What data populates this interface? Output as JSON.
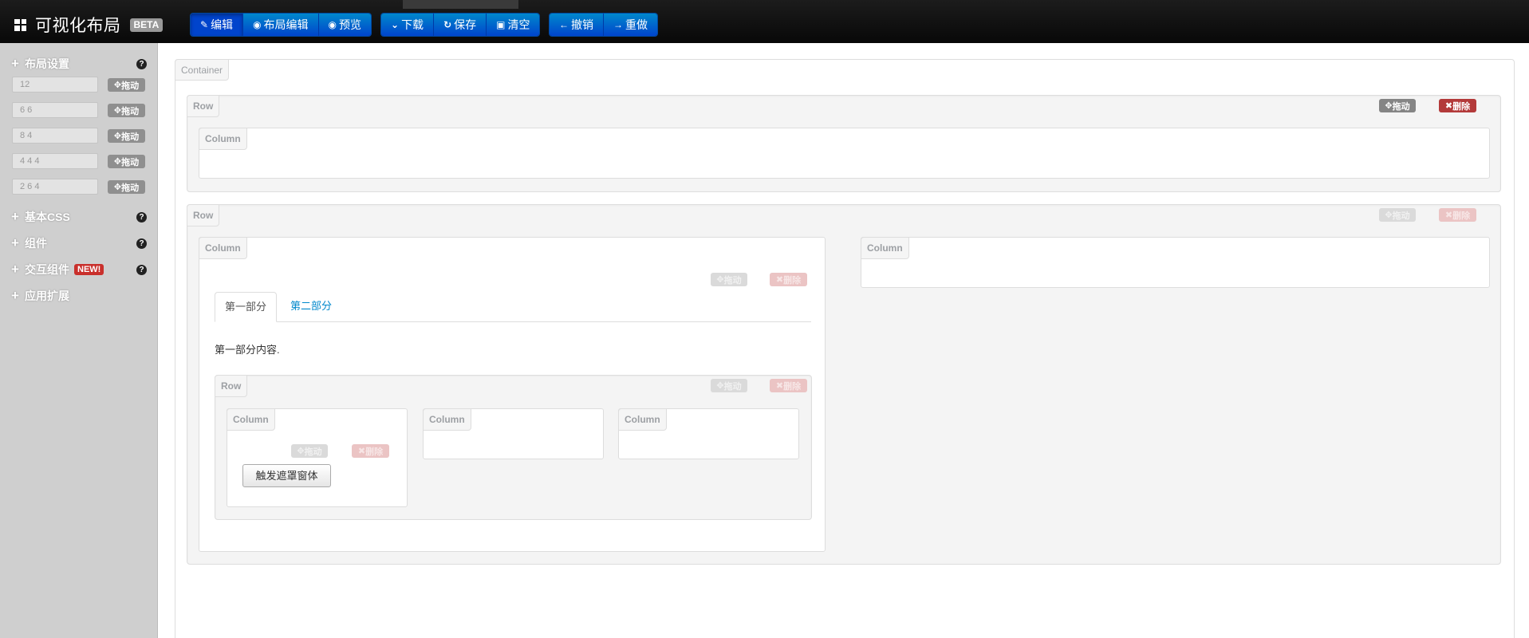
{
  "header": {
    "title": "可视化布局",
    "beta": "BETA",
    "groups": [
      [
        {
          "icon": "✎",
          "label": "编辑"
        },
        {
          "icon": "◉",
          "label": "布局编辑"
        },
        {
          "icon": "◉",
          "label": "预览"
        }
      ],
      [
        {
          "icon": "⌄",
          "label": "下载"
        },
        {
          "icon": "↻",
          "label": "保存"
        },
        {
          "icon": "▣",
          "label": "清空"
        }
      ],
      [
        {
          "icon": "←",
          "label": "撤销"
        },
        {
          "icon": "→",
          "label": "重做"
        }
      ]
    ]
  },
  "sidebar": {
    "layout_title": "布局设置",
    "grid_rows": [
      {
        "value": "12"
      },
      {
        "value": "6 6"
      },
      {
        "value": "8 4"
      },
      {
        "value": "4 4 4"
      },
      {
        "value": "2 6 4"
      }
    ],
    "drag_label": "拖动",
    "sections": [
      {
        "label": "基本CSS"
      },
      {
        "label": "组件"
      },
      {
        "label": "交互组件",
        "badge": "NEW!"
      },
      {
        "label": "应用扩展"
      }
    ],
    "help": "?",
    "plus": "+"
  },
  "canvas": {
    "container_label": "Container",
    "row_label": "Row",
    "column_label": "Column",
    "drag_label": "拖动",
    "remove_label": "删除",
    "tabs": [
      "第一部分",
      "第二部分"
    ],
    "tab_content": "第一部分内容.",
    "modal_button": "触发遮罩窗体"
  },
  "colors": {
    "topbar": "#111111",
    "primary": "#0044cc",
    "sidebar": "#cfcfcf",
    "danger": "#b33a3a"
  }
}
